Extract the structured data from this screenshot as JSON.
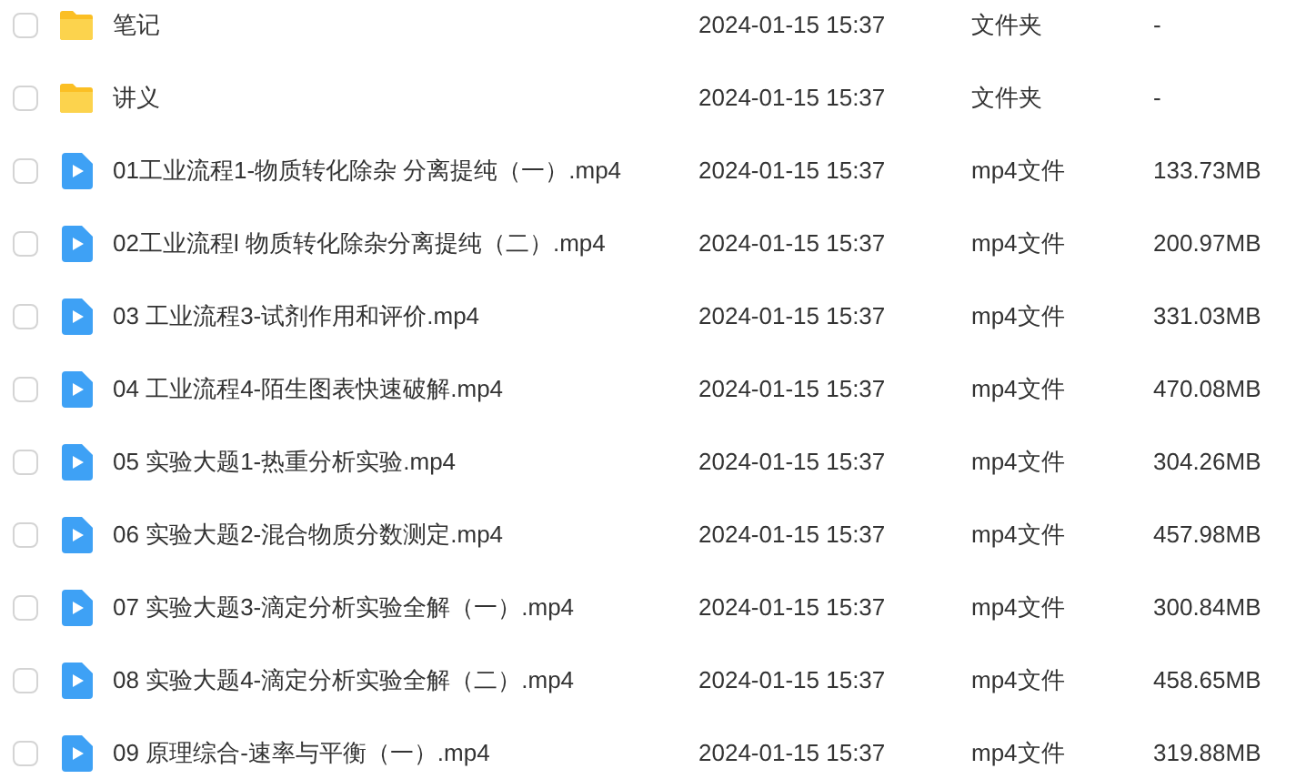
{
  "files": [
    {
      "kind": "folder",
      "checked": false,
      "name": "笔记",
      "modified": "2024-01-15 15:37",
      "type": "文件夹",
      "size": "-"
    },
    {
      "kind": "folder",
      "checked": false,
      "name": "讲义",
      "modified": "2024-01-15 15:37",
      "type": "文件夹",
      "size": "-"
    },
    {
      "kind": "video",
      "checked": false,
      "name": "01工业流程1-物质转化除杂 分离提纯（一）.mp4",
      "modified": "2024-01-15 15:37",
      "type": "mp4文件",
      "size": "133.73MB"
    },
    {
      "kind": "video",
      "checked": false,
      "name": "02工业流程l 物质转化除杂分离提纯（二）.mp4",
      "modified": "2024-01-15 15:37",
      "type": "mp4文件",
      "size": "200.97MB"
    },
    {
      "kind": "video",
      "checked": false,
      "name": "03 工业流程3-试剂作用和评价.mp4",
      "modified": "2024-01-15 15:37",
      "type": "mp4文件",
      "size": "331.03MB"
    },
    {
      "kind": "video",
      "checked": false,
      "name": "04 工业流程4-陌生图表快速破解.mp4",
      "modified": "2024-01-15 15:37",
      "type": "mp4文件",
      "size": "470.08MB"
    },
    {
      "kind": "video",
      "checked": false,
      "name": "05 实验大题1-热重分析实验.mp4",
      "modified": "2024-01-15 15:37",
      "type": "mp4文件",
      "size": "304.26MB"
    },
    {
      "kind": "video",
      "checked": false,
      "name": "06 实验大题2-混合物质分数测定.mp4",
      "modified": "2024-01-15 15:37",
      "type": "mp4文件",
      "size": "457.98MB"
    },
    {
      "kind": "video",
      "checked": false,
      "name": "07 实验大题3-滴定分析实验全解（一）.mp4",
      "modified": "2024-01-15 15:37",
      "type": "mp4文件",
      "size": "300.84MB"
    },
    {
      "kind": "video",
      "checked": false,
      "name": "08 实验大题4-滴定分析实验全解（二）.mp4",
      "modified": "2024-01-15 15:37",
      "type": "mp4文件",
      "size": "458.65MB"
    },
    {
      "kind": "video",
      "checked": false,
      "name": "09 原理综合-速率与平衡（一）.mp4",
      "modified": "2024-01-15 15:37",
      "type": "mp4文件",
      "size": "319.88MB"
    }
  ]
}
